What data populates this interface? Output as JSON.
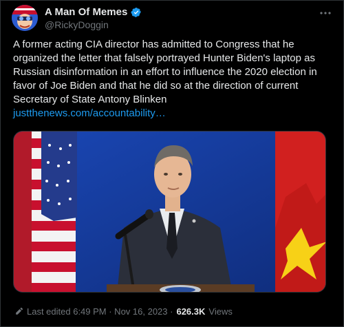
{
  "author": {
    "display_name": "A Man Of Memes",
    "handle": "@RickyDoggin",
    "verified": true
  },
  "more_icon": "ellipsis-icon",
  "tweet": {
    "text": "A former acting CIA director has admitted to Congress that he organized the letter that falsely portrayed Hunter Biden's laptop as Russian disinformation in an effort to influence the 2020 election in favor of Joe Biden and that he did so at the direction of current Secretary of State Antony Blinken",
    "link": "justthenews.com/accountability…"
  },
  "media": {
    "subject": "photo of a man in a dark suit speaking at a podium between a US flag and a red flag with a yellow star"
  },
  "footer": {
    "edited_label": "Last edited 6:49 PM · Nov 16, 2023 ·",
    "views_count": "626.3K",
    "views_label": "Views"
  },
  "colors": {
    "background": "#000000",
    "link": "#1d9bf0",
    "secondary_text": "#71767b",
    "verified_badge": "#1d9bf0"
  }
}
